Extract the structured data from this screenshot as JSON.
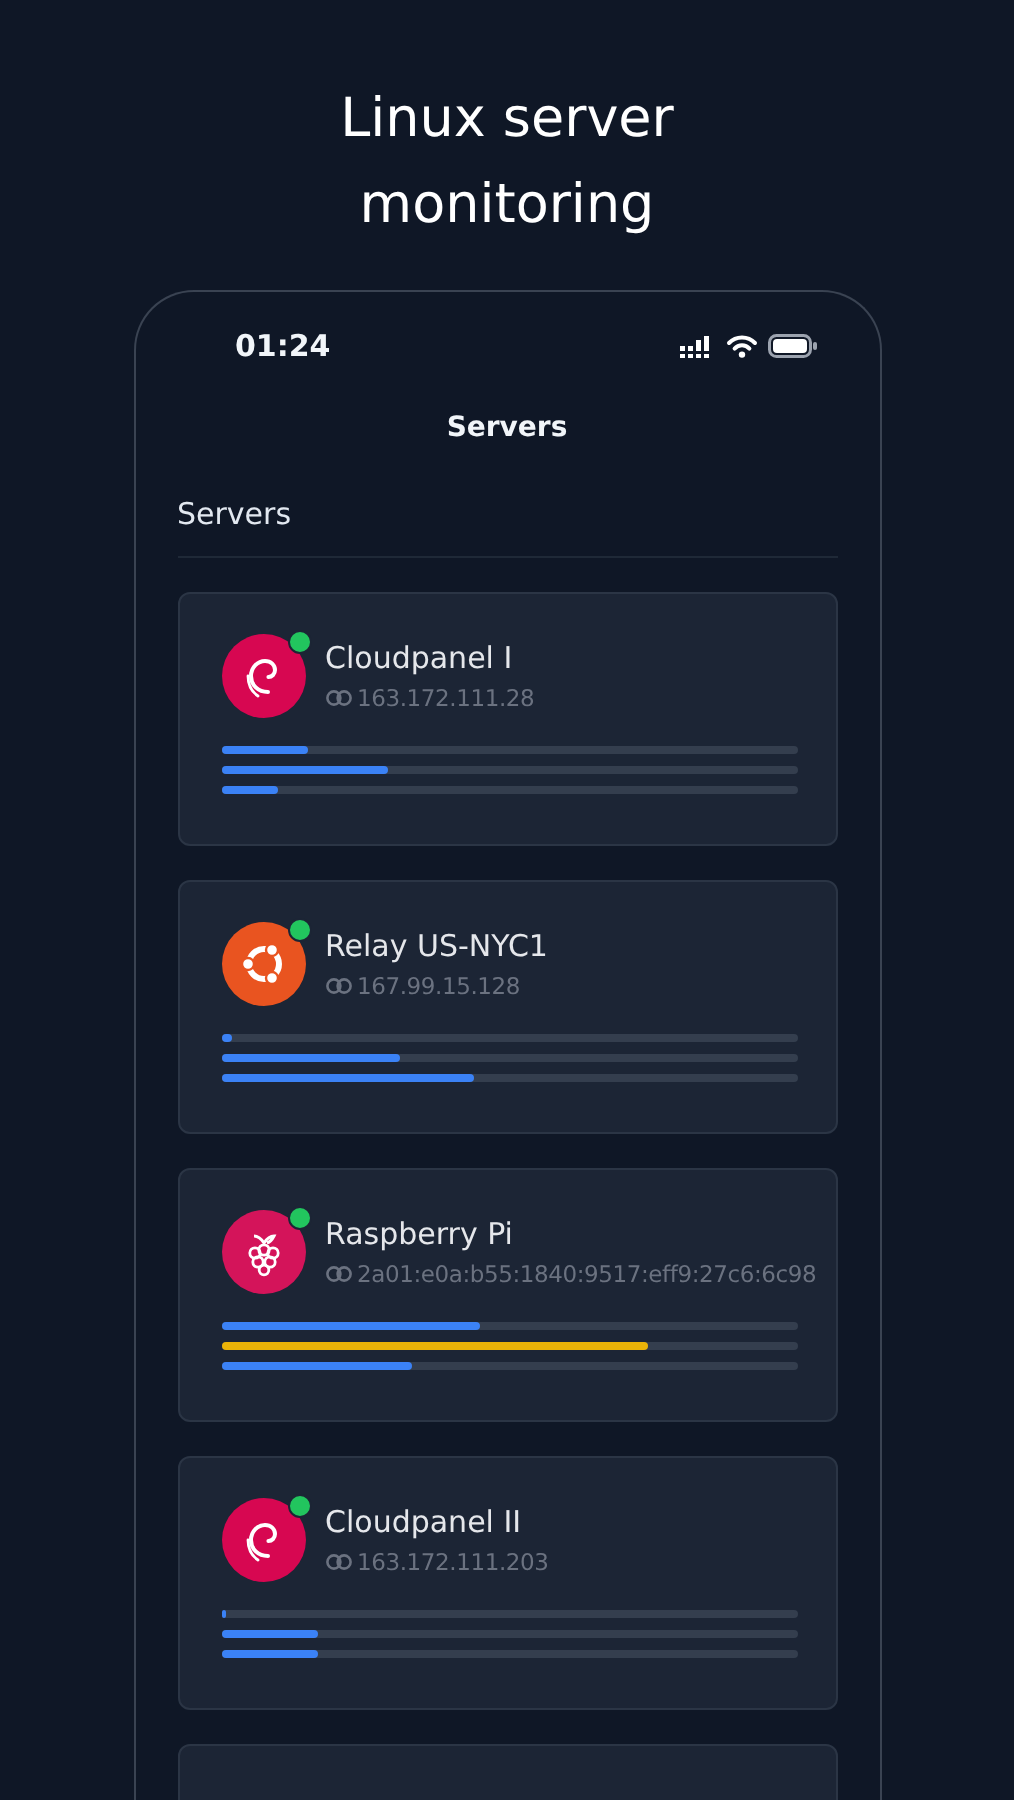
{
  "headline": "Linux server monitoring",
  "status_bar": {
    "time": "01:24"
  },
  "nav_title": "Servers",
  "section_title": "Servers",
  "servers": [
    {
      "name": "Cloudpanel I",
      "address": "163.172.111.28",
      "kind": "debian",
      "online": true,
      "bars": [
        {
          "level": 0.15,
          "color": "#3b82f6"
        },
        {
          "level": 0.29,
          "color": "#3b82f6"
        },
        {
          "level": 0.1,
          "color": "#3b82f6"
        }
      ]
    },
    {
      "name": "Relay US-NYC1",
      "address": "167.99.15.128",
      "kind": "ubuntu",
      "online": true,
      "bars": [
        {
          "level": 0.02,
          "color": "#3b82f6"
        },
        {
          "level": 0.31,
          "color": "#3b82f6"
        },
        {
          "level": 0.44,
          "color": "#3b82f6"
        }
      ]
    },
    {
      "name": "Raspberry Pi",
      "address": "2a01:e0a:b55:1840:9517:eff9:27c6:6c98",
      "kind": "raspberry",
      "online": true,
      "bars": [
        {
          "level": 0.45,
          "color": "#3b82f6"
        },
        {
          "level": 0.74,
          "color": "#eab308"
        },
        {
          "level": 0.33,
          "color": "#3b82f6"
        }
      ]
    },
    {
      "name": "Cloudpanel II",
      "address": "163.172.111.203",
      "kind": "debian",
      "online": true,
      "bars": [
        {
          "level": 0.01,
          "color": "#3b82f6"
        },
        {
          "level": 0.17,
          "color": "#3b82f6"
        },
        {
          "level": 0.17,
          "color": "#3b82f6"
        }
      ]
    }
  ]
}
